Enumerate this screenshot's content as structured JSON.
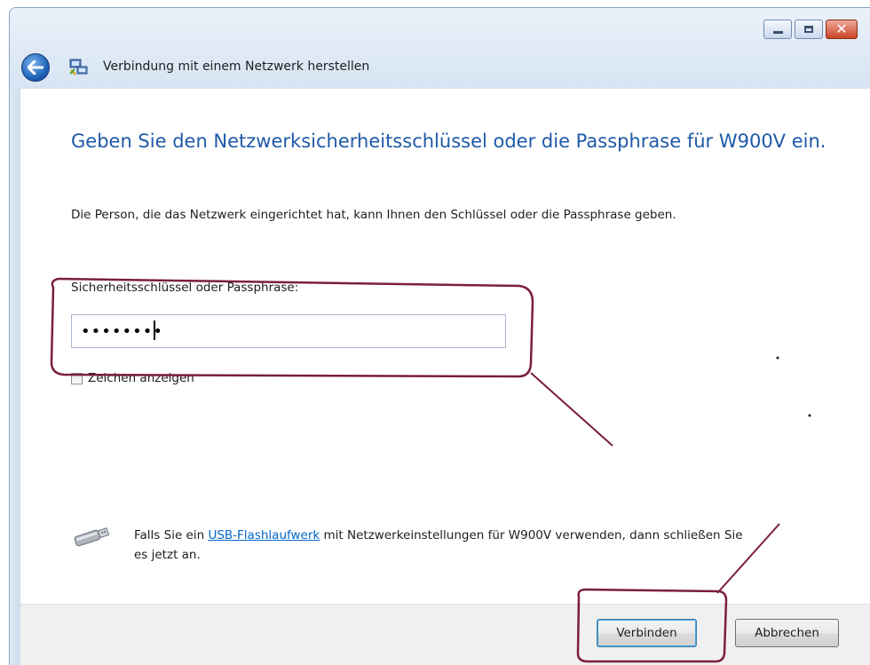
{
  "window": {
    "title": "Verbindung mit einem Netzwerk herstellen",
    "controls": [
      "minimize",
      "maximize",
      "close"
    ]
  },
  "content": {
    "heading": "Geben Sie den Netzwerksicherheitsschlüssel oder die Passphrase für W900V ein.",
    "instruction": "Die Person, die das Netzwerk eingerichtet hat, kann Ihnen den Schlüssel oder die Passphrase geben.",
    "key_label": "Sicherheitsschlüssel oder Passphrase:",
    "key_value": "••••••••",
    "show_chars_label": "Zeichen anzeigen",
    "show_chars_checked": false,
    "usb_text_before": "Falls Sie ein ",
    "usb_link": "USB-Flashlaufwerk",
    "usb_text_after": " mit Netzwerkeinstellungen für W900V verwenden, dann schließen Sie es jetzt an."
  },
  "buttons": {
    "connect": "Verbinden",
    "cancel": "Abbrechen"
  },
  "colors": {
    "heading": "#1e5aa8",
    "link": "#0066cc",
    "annotation": "#7a1f3d"
  },
  "icons": [
    "back-arrow-icon",
    "network-icon",
    "usb-flash-drive-icon"
  ]
}
